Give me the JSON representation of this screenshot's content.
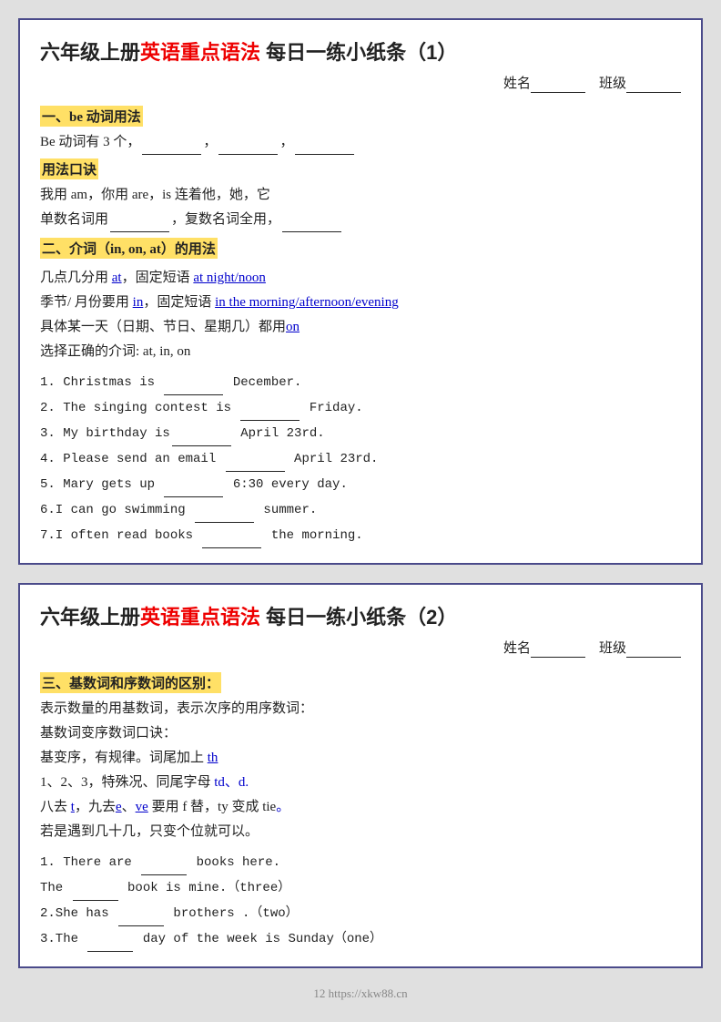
{
  "card1": {
    "title_prefix": "六年级上册",
    "title_red": "英语重点语法",
    "title_suffix": " 每日一练小纸条（1）",
    "name_label": "姓名",
    "class_label": "班级",
    "section1_title": "一、be 动词用法",
    "be_line1": "Be 动词有 3 个，",
    "be_line1_suffix": "，",
    "be_line1_suffix2": "，",
    "mnemonic_title": "用法口诀",
    "mnemonic1": "我用 am，你用 are，is 连着他，她，它",
    "mnemonic2_prefix": "单数名词用",
    "mnemonic2_suffix": "，复数名词全用，",
    "section2_title": "二、介词（in, on, at）的用法",
    "preposition1_prefix": "几点几分用 ",
    "preposition1_at": "at",
    "preposition1_suffix": "，固定短语 ",
    "preposition1_phrase": "at night/noon",
    "preposition2_prefix": "季节/ 月份要用 ",
    "preposition2_in": "in",
    "preposition2_suffix": "，固定短语 ",
    "preposition2_phrase": "in the morning/afternoon/evening",
    "preposition3_prefix": "具体某一天（日期、节日、星期几）都用",
    "preposition3_on": "on",
    "preposition4": "选择正确的介词: at, in, on",
    "exercises": [
      "1.  Christmas is _________ December.",
      "2.  The singing contest is _________ Friday.",
      "3.  My birthday is_________ April 23rd.",
      "4.  Please send an email _________ April 23rd.",
      "5.  Mary gets up _________ 6:30 every day.",
      "6.I can go swimming _________ summer.",
      "7.I often read books _________ the morning."
    ]
  },
  "card2": {
    "title_prefix": "六年级上册",
    "title_red": "英语重点语法",
    "title_suffix": " 每日一练小纸条（2）",
    "name_label": "姓名",
    "class_label": "班级",
    "section3_title": "三、基数词和序数词的区别：",
    "line1": "表示数量的用基数词，表示次序的用序数词：",
    "line2": "基数词变序数词口诀：",
    "line3": "基变序，有规律。词尾加上 th",
    "line4_prefix": "1、2、3，特殊况、同尾字母 td、d.",
    "line5_prefix": "八去 t，九去",
    "line5_e": "e",
    "line5_ve": "ve",
    "line5_mid": " 要用 f 替，ty 变成 tie",
    "line5_dot": "。",
    "line6": "若是遇到几十几，只变个位就可以。",
    "exercises2": [
      {
        "line1": "1. There are ________ books here.",
        "line2": "The  ________ book is mine.（three）"
      },
      {
        "line1": "2.She has ________ brothers .（two）"
      },
      {
        "line1": "3.The  ________ day of the week is Sunday（one）"
      }
    ]
  },
  "footer": {
    "text": "12 https://xkw88.cn"
  }
}
